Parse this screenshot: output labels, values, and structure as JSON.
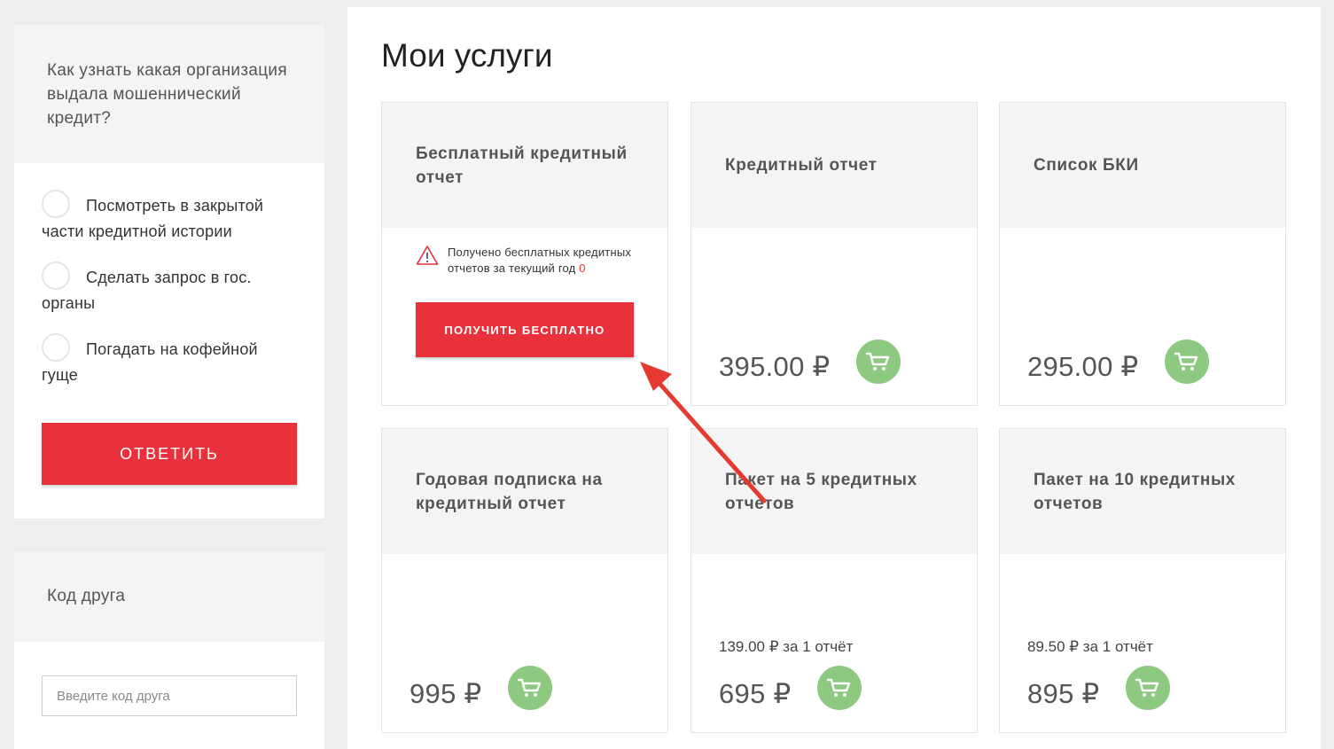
{
  "poll": {
    "question": "Как узнать какая организация выдала мошеннический кредит?",
    "options": [
      "Посмотреть в закрытой части кредитной истории",
      "Сделать запрос в гос. органы",
      "Погадать на кофейной гуще"
    ],
    "answer_label": "ОТВЕТИТЬ"
  },
  "friend": {
    "title": "Код друга",
    "placeholder": "Введите код друга"
  },
  "main": {
    "title": "Мои услуги",
    "cards": [
      {
        "title": "Бесплатный кредитный отчет",
        "warning": "Получено бесплатных кредитных отчетов за текущий год",
        "count": "0",
        "button": "ПОЛУЧИТЬ БЕСПЛАТНО"
      },
      {
        "title": "Кредитный отчет",
        "price": "395.00 ₽"
      },
      {
        "title": "Список БКИ",
        "price": "295.00 ₽"
      },
      {
        "title": "Годовая подписка на кредитный отчет",
        "price": "995 ₽"
      },
      {
        "title": "Пакет на 5 кредитных отчетов",
        "per_report": "139.00 ₽ за 1 отчёт",
        "price": "695 ₽"
      },
      {
        "title": "Пакет на 10 кредитных отчетов",
        "per_report": "89.50 ₽ за 1 отчёт",
        "price": "895 ₽"
      }
    ]
  },
  "colors": {
    "accent_red": "#e8313a",
    "cart_green": "#8ec981",
    "page_bg": "#eeeeef"
  },
  "icons": [
    "warning-icon",
    "cart-icon",
    "arrow-annotation"
  ]
}
